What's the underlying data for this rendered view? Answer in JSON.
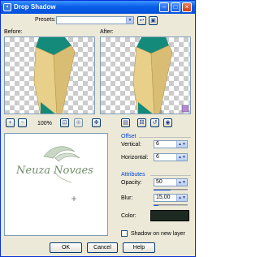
{
  "window": {
    "title": "Drop Shadow"
  },
  "presets": {
    "label": "Presets:",
    "value": ""
  },
  "previews": {
    "before_label": "Before:",
    "after_label": "After:"
  },
  "zoom": {
    "level": "100%"
  },
  "navigator": {
    "signature_text": "Neuza Novaes"
  },
  "offset": {
    "group_label": "Offset",
    "vertical_label": "Vertical:",
    "vertical_value": "6",
    "horizontal_label": "Horizontal:",
    "horizontal_value": "6"
  },
  "attributes": {
    "group_label": "Attributes",
    "opacity_label": "Opacity:",
    "opacity_value": "50",
    "opacity_fraction": 0.5,
    "blur_label": "Blur:",
    "blur_value": "15,00",
    "blur_fraction": 0.15,
    "color_label": "Color:",
    "color_value": "#1d2a22"
  },
  "shadow_on_new_layer": {
    "label": "Shadow on new layer",
    "checked": false
  },
  "buttons": {
    "ok": "OK",
    "cancel": "Cancel",
    "help": "Help"
  },
  "colors": {
    "titlebar": "#0a5ee8",
    "accent": "#0046d5",
    "clothing_teal": "#138a7a",
    "skin": "#e8cf8a"
  }
}
